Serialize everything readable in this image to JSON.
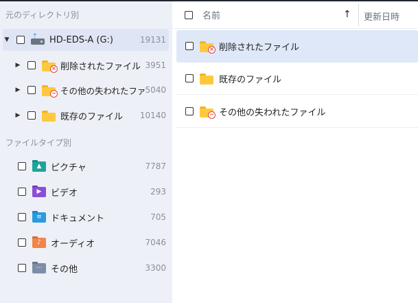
{
  "sidebar": {
    "section_dirs": "元のディレクトリ別",
    "drive": {
      "label": "HD-EDS-A (G:)",
      "count": "19131"
    },
    "folders": [
      {
        "label": "削除されたファイル",
        "count": "3951",
        "icon": "deleted-folder-icon"
      },
      {
        "label": "その他の失われたファイル",
        "count": "5040",
        "icon": "lost-folder-icon"
      },
      {
        "label": "既存のファイル",
        "count": "10140",
        "icon": "folder-icon"
      }
    ],
    "section_types": "ファイルタイプ別",
    "types": [
      {
        "label": "ピクチャ",
        "count": "7787",
        "icon": "picture-folder-icon"
      },
      {
        "label": "ビデオ",
        "count": "293",
        "icon": "video-folder-icon"
      },
      {
        "label": "ドキュメント",
        "count": "705",
        "icon": "document-folder-icon"
      },
      {
        "label": "オーディオ",
        "count": "7046",
        "icon": "audio-folder-icon"
      },
      {
        "label": "その他",
        "count": "3300",
        "icon": "other-folder-icon"
      }
    ]
  },
  "main": {
    "header": {
      "name": "名前",
      "date": "更新日時",
      "sort": "↑"
    },
    "rows": [
      {
        "label": "削除されたファイル",
        "icon": "deleted-folder-icon"
      },
      {
        "label": "既存のファイル",
        "icon": "folder-icon"
      },
      {
        "label": "その他の失われたファイル",
        "icon": "lost-folder-icon"
      }
    ]
  },
  "colors": {
    "sidebar_bg": "#eef0f7",
    "selection_bg": "#dfe5f4",
    "folder_yellow": "#ffc83d",
    "badge_red": "#e0453a",
    "muted_text": "#8a8f9c"
  }
}
